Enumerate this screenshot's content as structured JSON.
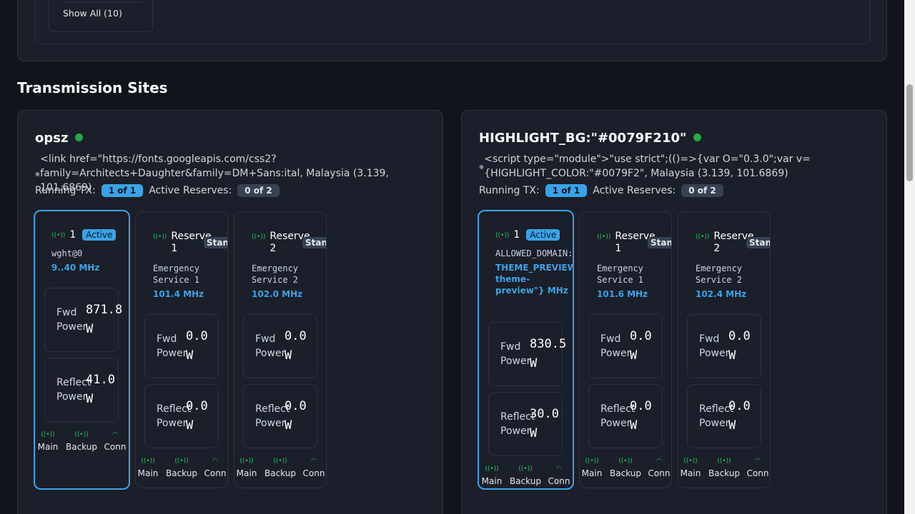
{
  "prev": {
    "show_all": "Show All (10)"
  },
  "section_title": "Transmission Sites",
  "labels": {
    "running_tx": "Running TX:",
    "active_reserves": "Active Reserves:",
    "fwd": "Fwd Power",
    "reflect": "Reflect Power",
    "unit": "W",
    "main": "Main",
    "backup": "Backup",
    "conn": "Conn",
    "active": "Active",
    "standby": "Standby"
  },
  "sites": [
    {
      "name": "opsz",
      "location": "<link href=\"https://fonts.googleapis.com/css2?family=Architects+Daughter&family=DM+Sans:ital, Malaysia (3.139, 101.6869)",
      "running": "1 of 1",
      "reserves": "0 of 2",
      "tx": [
        {
          "name": "1",
          "desc": "wght@0",
          "freq": "9..40 MHz",
          "fwd": "871.8",
          "reflect": "41.0"
        },
        {
          "name": "Reserve 1",
          "desc": "Emergency Service 1",
          "freq": "101.4 MHz",
          "fwd": "0.0",
          "reflect": "0.0"
        },
        {
          "name": "Reserve 2",
          "desc": "Emergency Service 2",
          "freq": "102.0 MHz",
          "fwd": "0.0",
          "reflect": "0.0"
        }
      ]
    },
    {
      "name": "HIGHLIGHT_BG:\"#0079F210\"",
      "location": "<script type=\"module\">\"use strict\";(()=>{var O=\"0.3.0\";var v={HIGHLIGHT_COLOR:\"#0079F2\", Malaysia (3.139, 101.6869)",
      "running": "1 of 1",
      "reserves": "0 of 2",
      "tx": [
        {
          "name": "1",
          "desc": "ALLOWED_DOMAIN:\"",
          "freq": "THEME_PREVIEW_ST theme-preview\"} MHz",
          "fwd": "830.5",
          "reflect": "30.0"
        },
        {
          "name": "Reserve 1",
          "desc": "Emergency Service 1",
          "freq": "101.6 MHz",
          "fwd": "0.0",
          "reflect": "0.0"
        },
        {
          "name": "Reserve 2",
          "desc": "Emergency Service 2",
          "freq": "102.4 MHz",
          "fwd": "0.0",
          "reflect": "0.0"
        }
      ]
    }
  ]
}
